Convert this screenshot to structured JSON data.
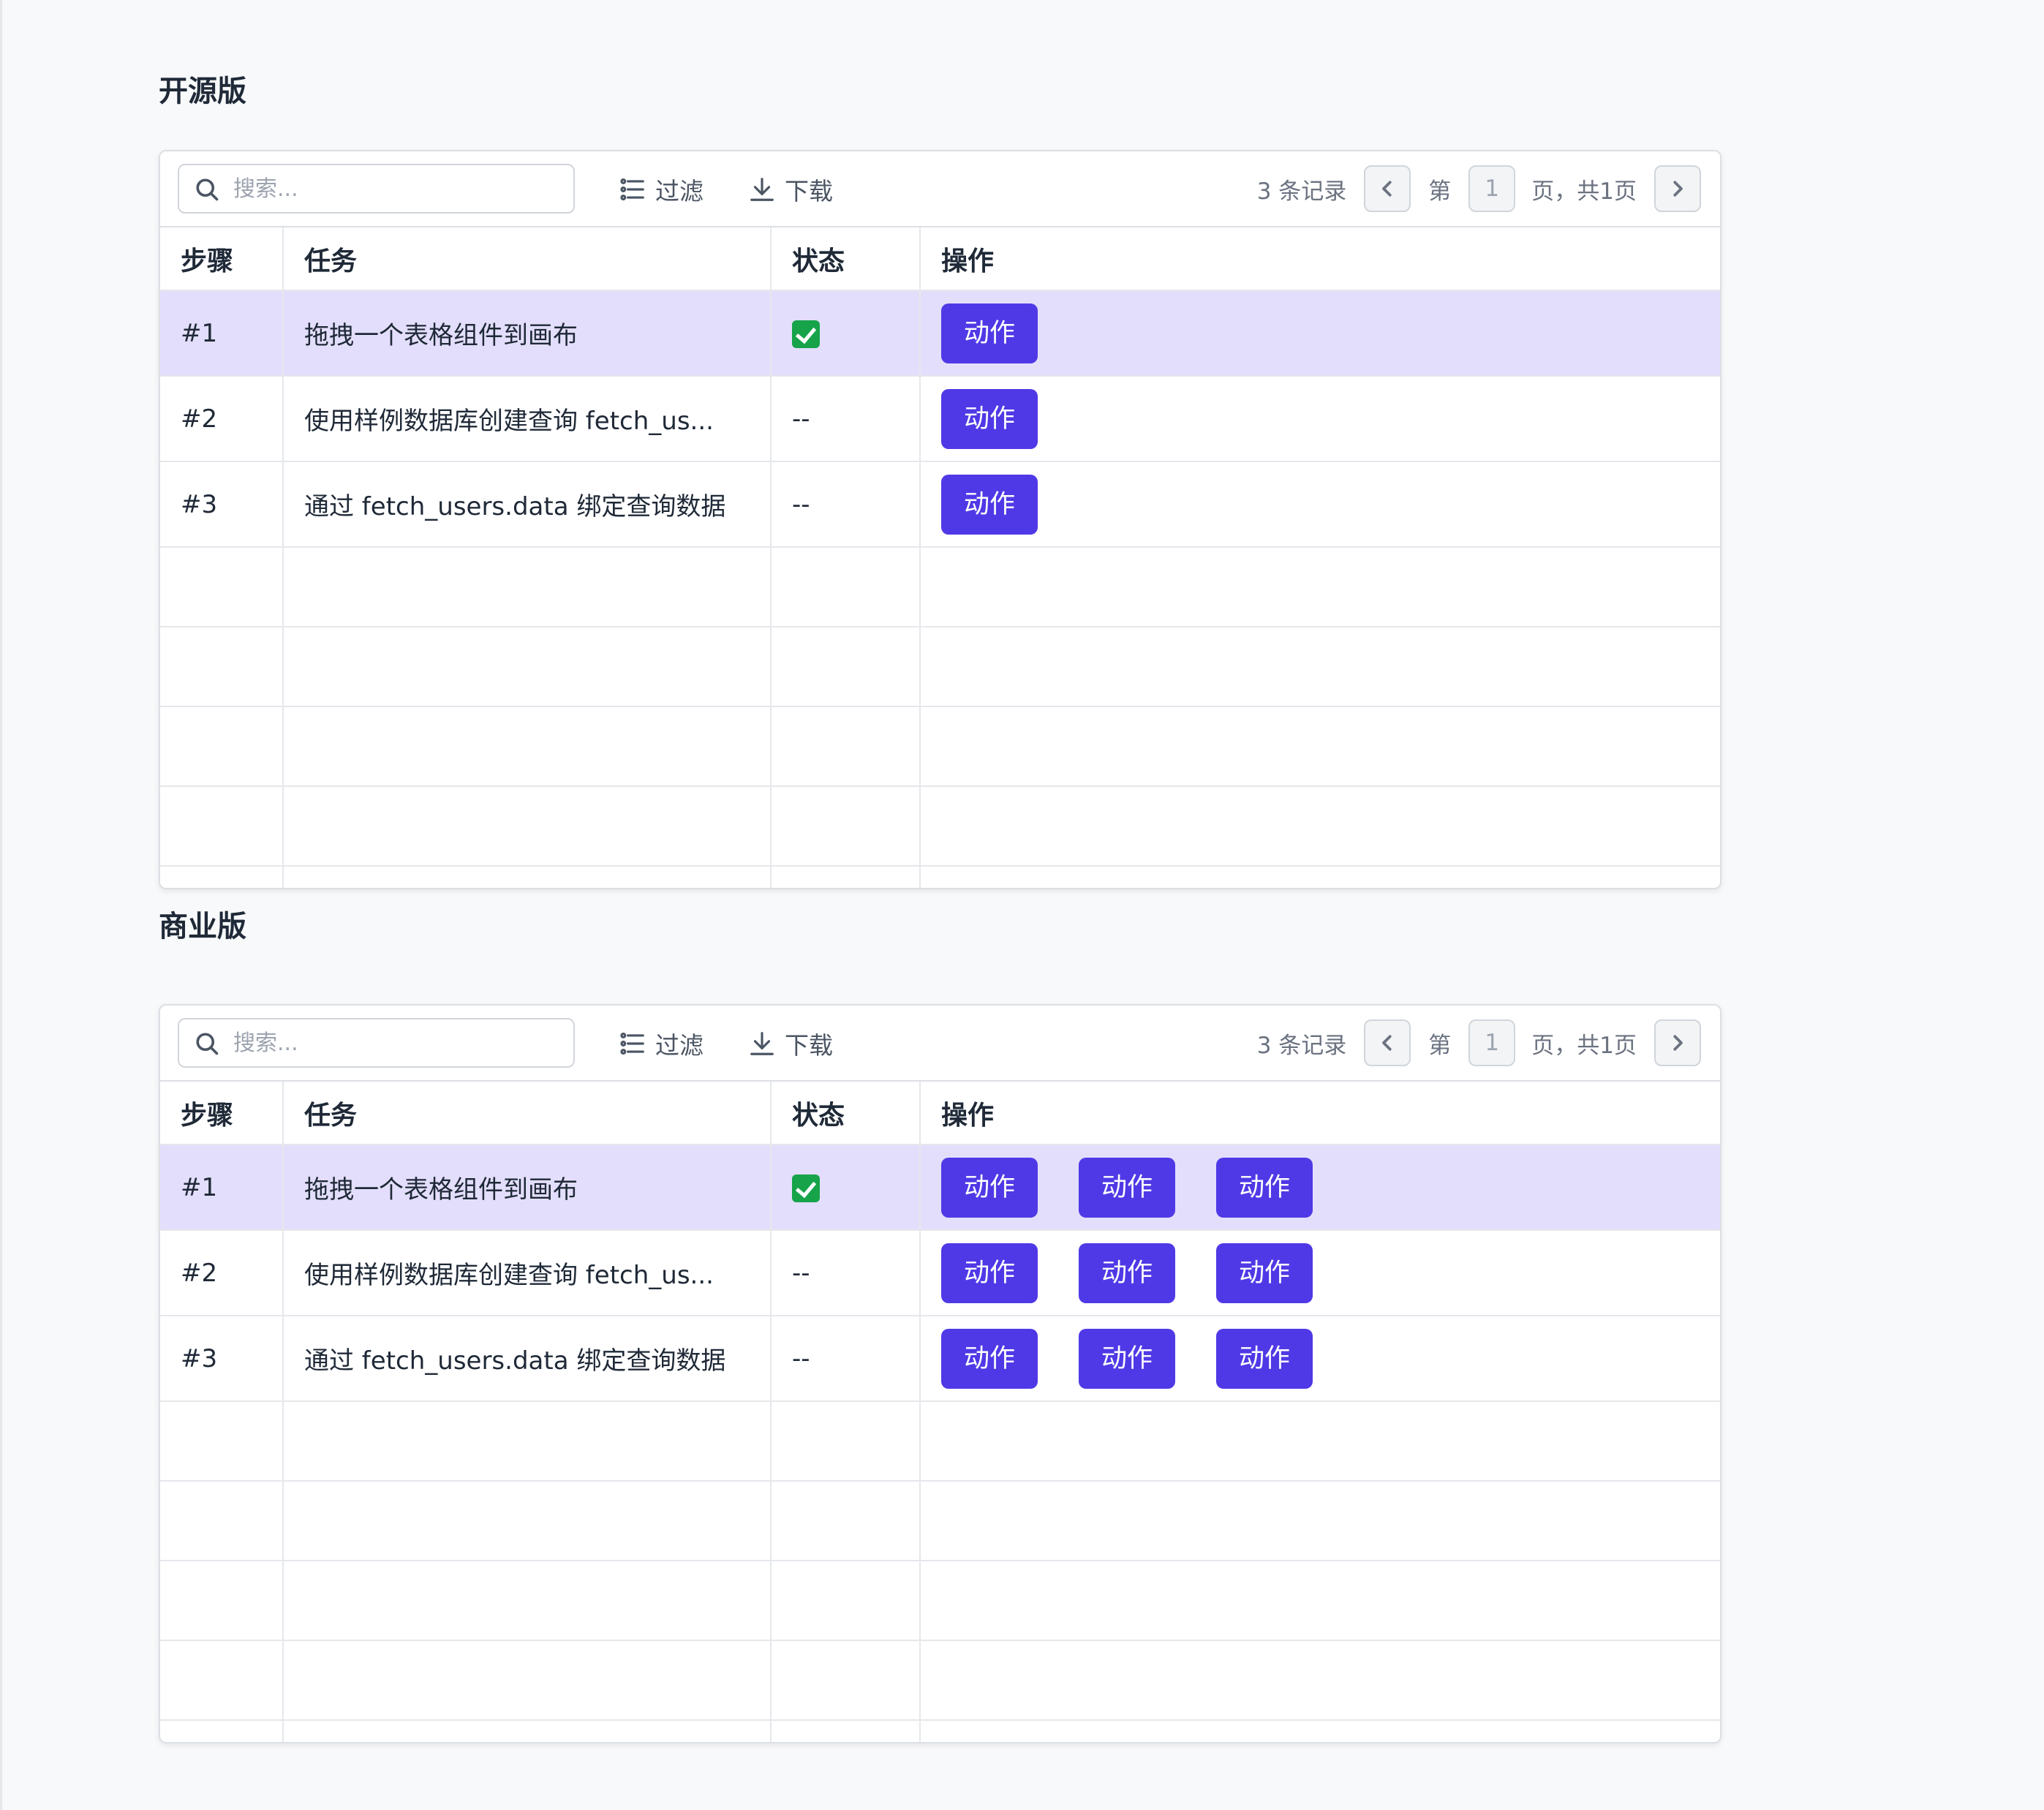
{
  "sections": [
    {
      "title": "开源版",
      "search": {
        "placeholder": "搜索..."
      },
      "toolbar": {
        "filter_label": "过滤",
        "download_label": "下载"
      },
      "pager": {
        "count": "3 条记录",
        "page_prefix": "第",
        "page": "1",
        "page_suffix": "页，共1页"
      },
      "columns": [
        "步骤",
        "任务",
        "状态",
        "操作"
      ],
      "rows": [
        {
          "step": "#1",
          "task": "拖拽一个表格组件到画布",
          "status": "check",
          "actions": [
            "动作"
          ]
        },
        {
          "step": "#2",
          "task": "使用样例数据库创建查询 fetch_us...",
          "status": "--",
          "actions": [
            "动作"
          ]
        },
        {
          "step": "#3",
          "task": "通过 fetch_users.data 绑定查询数据",
          "status": "--",
          "actions": [
            "动作"
          ]
        }
      ]
    },
    {
      "title": "商业版",
      "search": {
        "placeholder": "搜索..."
      },
      "toolbar": {
        "filter_label": "过滤",
        "download_label": "下载"
      },
      "pager": {
        "count": "3 条记录",
        "page_prefix": "第",
        "page": "1",
        "page_suffix": "页，共1页"
      },
      "columns": [
        "步骤",
        "任务",
        "状态",
        "操作"
      ],
      "rows": [
        {
          "step": "#1",
          "task": "拖拽一个表格组件到画布",
          "status": "check",
          "actions": [
            "动作",
            "动作",
            "动作"
          ]
        },
        {
          "step": "#2",
          "task": "使用样例数据库创建查询 fetch_us...",
          "status": "--",
          "actions": [
            "动作",
            "动作",
            "动作"
          ]
        },
        {
          "step": "#3",
          "task": "通过 fetch_users.data 绑定查询数据",
          "status": "--",
          "actions": [
            "动作",
            "动作",
            "动作"
          ]
        }
      ]
    }
  ],
  "colors": {
    "accent": "#4f39e6",
    "selected_row": "#e3defb",
    "check": "#16a34a"
  },
  "icons": {
    "search": "search-icon",
    "filter": "filter-icon",
    "download": "download-icon",
    "prev": "chevron-left-icon",
    "next": "chevron-right-icon",
    "status_done": "check-icon"
  }
}
